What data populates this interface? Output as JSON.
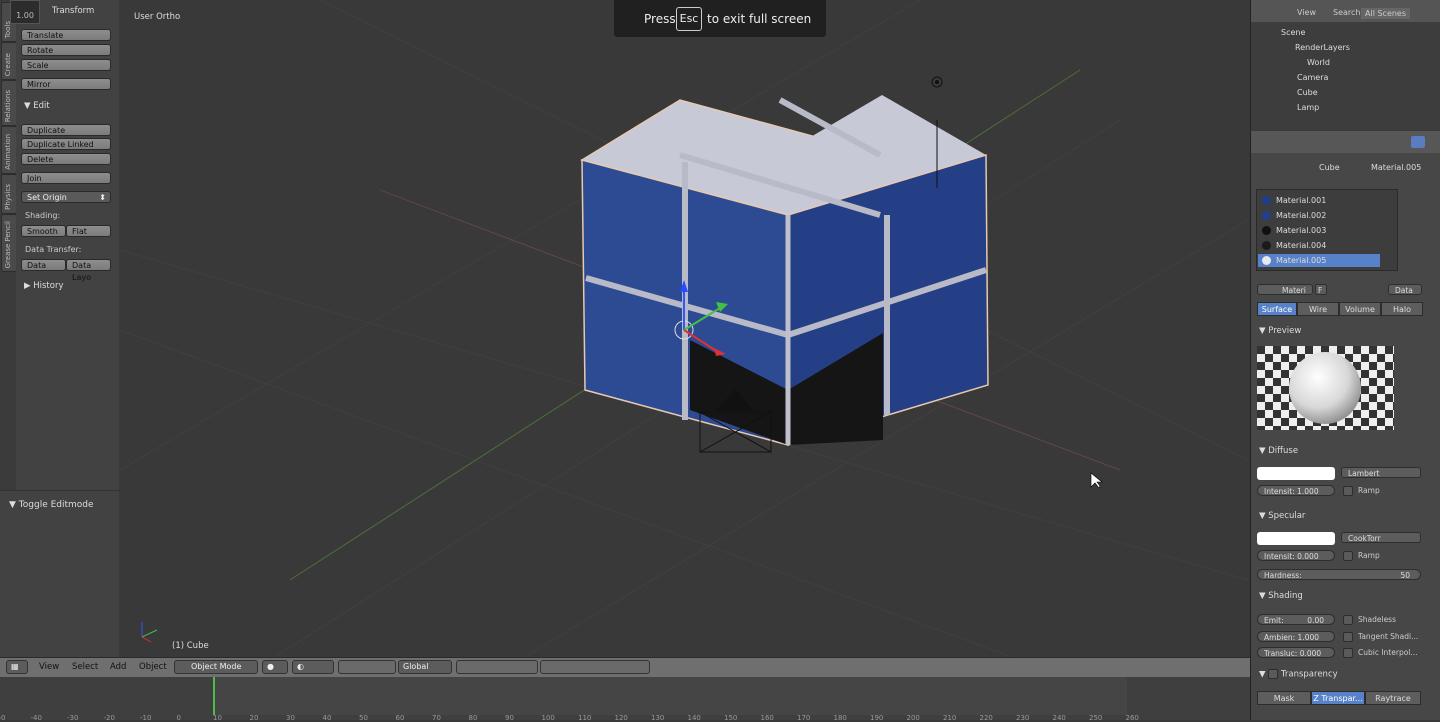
{
  "toast": {
    "press": "Press",
    "key": "Esc",
    "rest": "to exit full screen"
  },
  "toolshelf": {
    "value": "1.00",
    "transform_header": "Transform",
    "translate": "Translate",
    "rotate": "Rotate",
    "scale": "Scale",
    "mirror": "Mirror",
    "edit_header": "Edit",
    "duplicate": "Duplicate",
    "duplicate_linked": "Duplicate Linked",
    "delete": "Delete",
    "join": "Join",
    "set_origin": "Set Origin",
    "shading_label": "Shading:",
    "smooth": "Smooth",
    "flat": "Flat",
    "data_transfer_label": "Data Transfer:",
    "data": "Data",
    "data_layout": "Data Layo",
    "history_header": "History",
    "tabs": [
      "Tools",
      "Create",
      "Relations",
      "Animation",
      "Physics",
      "Grease Pencil"
    ]
  },
  "operator_panel": {
    "title": "Toggle Editmode"
  },
  "viewport": {
    "view_label": "User Ortho",
    "object_label": "(1) Cube"
  },
  "header": {
    "menus": [
      "View",
      "Select",
      "Add",
      "Object"
    ],
    "mode": "Object Mode",
    "orientation": "Global"
  },
  "timeline": {
    "ticks": [
      "-50",
      "-40",
      "-30",
      "-20",
      "-10",
      "0",
      "10",
      "20",
      "30",
      "40",
      "50",
      "60",
      "70",
      "80",
      "90",
      "100",
      "110",
      "120",
      "130",
      "140",
      "150",
      "160",
      "170",
      "180",
      "190",
      "200",
      "210",
      "220",
      "230",
      "240",
      "250",
      "260"
    ]
  },
  "outliner": {
    "tabs": [
      "View",
      "Search",
      "All Scenes"
    ],
    "items": [
      "Scene",
      "RenderLayers",
      "World",
      "Camera",
      "Cube",
      "Lamp"
    ]
  },
  "properties": {
    "breadcrumb": [
      "Cube",
      "Material.005"
    ],
    "materials": [
      "Material.001",
      "Material.002",
      "Material.003",
      "Material.004",
      "Material.005"
    ],
    "material_swatch_colors": [
      "#1f3f8a",
      "#23408f",
      "#111111",
      "#1a1a1a",
      "#e8e8f0"
    ],
    "selected_index": 4,
    "datablock_name": "Materi",
    "datablock_flag": "F",
    "data_select": "Data",
    "surface_tabs": [
      "Surface",
      "Wire",
      "Volume",
      "Halo"
    ],
    "preview_header": "Preview",
    "diffuse": {
      "header": "Diffuse",
      "shader": "Lambert",
      "intensity": "Intensit: 1.000",
      "ramp": "Ramp"
    },
    "specular": {
      "header": "Specular",
      "shader": "CookTorr",
      "intensity": "Intensit: 0.000",
      "ramp": "Ramp",
      "hardness_label": "Hardness:",
      "hardness_value": "50"
    },
    "shading": {
      "header": "Shading",
      "emit_label": "Emit:",
      "emit_value": "0.00",
      "shadeless": "Shadeless",
      "ambient": "Ambien: 1.000",
      "tangent": "Tangent Shadi...",
      "translucency": "Transluc: 0.000",
      "cubic": "Cubic Interpol..."
    },
    "transparency": {
      "header": "Transparency",
      "modes": [
        "Mask",
        "Z Transpar...",
        "Raytrace"
      ]
    }
  }
}
